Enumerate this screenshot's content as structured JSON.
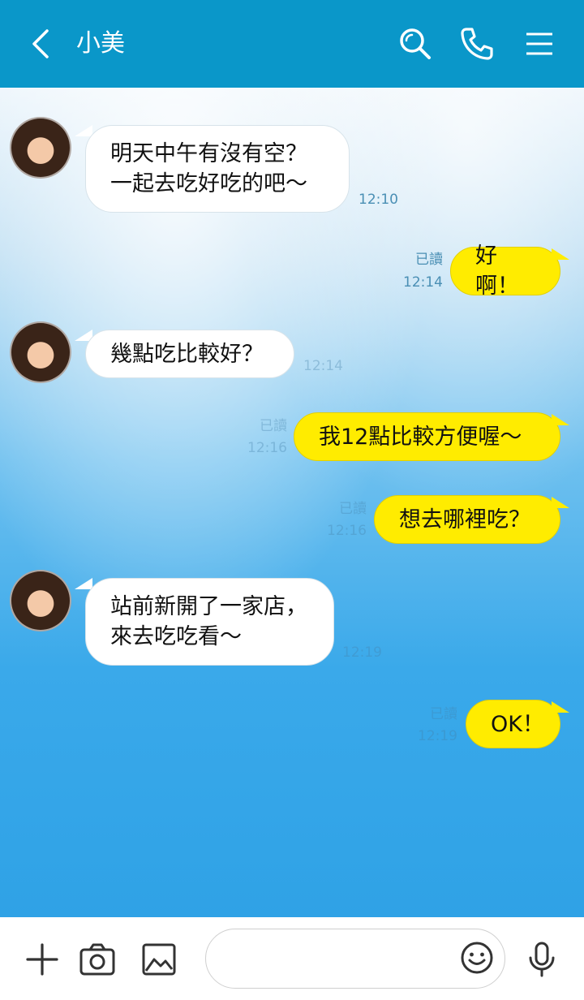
{
  "header": {
    "contact_name": "小美",
    "back_icon": "chevron-left-icon",
    "search_icon": "search-icon",
    "call_icon": "phone-icon",
    "menu_icon": "menu-icon"
  },
  "messages": [
    {
      "direction": "in",
      "text": "明天中午有沒有空？\n一起去吃好吃的吧〜",
      "time": "12:10"
    },
    {
      "direction": "out",
      "text": "好啊！",
      "read": "已讀",
      "time": "12:14"
    },
    {
      "direction": "in",
      "text": "幾點吃比較好？",
      "time": "12:14"
    },
    {
      "direction": "out",
      "text": "我12點比較方便喔〜",
      "read": "已讀",
      "time": "12:16"
    },
    {
      "direction": "out",
      "text": "想去哪裡吃？",
      "read": "已讀",
      "time": "12:16"
    },
    {
      "direction": "in",
      "text": "站前新開了一家店，\n來去吃吃看〜",
      "time": "12:19"
    },
    {
      "direction": "out",
      "text": "OK！",
      "read": "已讀",
      "time": "12:19"
    }
  ],
  "composer": {
    "input_value": "",
    "input_placeholder": "",
    "icons": [
      "plus-icon",
      "camera-icon",
      "image-icon",
      "emoji-icon",
      "microphone-icon"
    ]
  },
  "colors": {
    "header_bg": "#0a97c9",
    "outgoing_bubble": "#ffec00",
    "incoming_bubble": "#ffffff"
  }
}
